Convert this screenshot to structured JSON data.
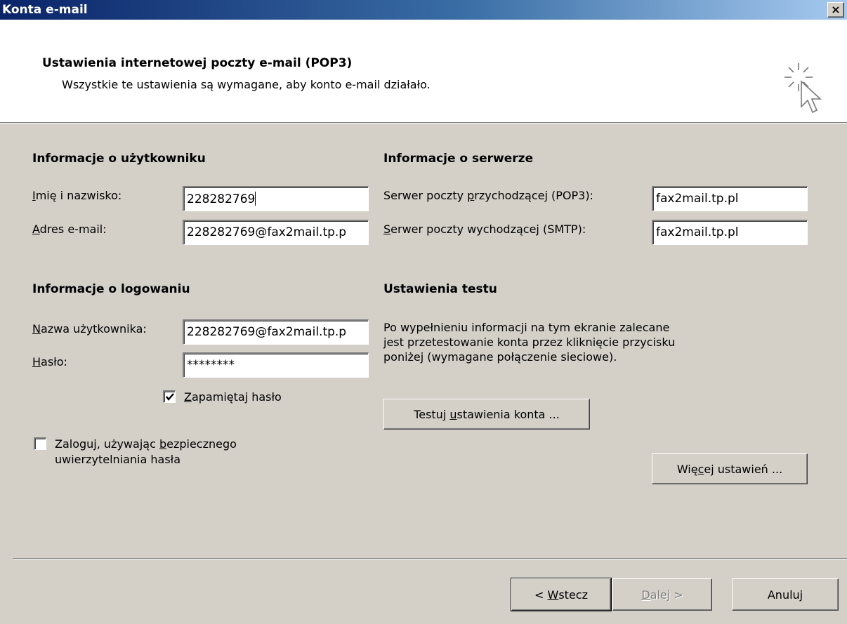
{
  "window": {
    "title": "Konta e-mail",
    "close_glyph": "×"
  },
  "header": {
    "title": "Ustawienia internetowej poczty e-mail (POP3)",
    "subtitle": "Wszystkie te ustawienia są wymagane, aby konto e-mail działało.",
    "icon": "wizard-cursor-sparkle-icon"
  },
  "user_info": {
    "heading": "Informacje o użytkowniku",
    "name_label_key": "I",
    "name_label_rest": "mię i nazwisko:",
    "name_value": "228282769",
    "email_label_key": "A",
    "email_label_rest": "dres e-mail:",
    "email_value": "228282769@fax2mail.tp.p"
  },
  "server_info": {
    "heading": "Informacje o serwerze",
    "incoming_label_pre": "Serwer poczty ",
    "incoming_label_key": "p",
    "incoming_label_rest": "rzychodzącej (POP3):",
    "incoming_value": "fax2mail.tp.pl",
    "outgoing_label_key": "S",
    "outgoing_label_rest": "erwer poczty wychodzącej (SMTP):",
    "outgoing_value": "fax2mail.tp.pl"
  },
  "login_info": {
    "heading": "Informacje o logowaniu",
    "username_label_key": "N",
    "username_label_rest": "azwa użytkownika:",
    "username_value": "228282769@fax2mail.tp.p",
    "password_label_key": "H",
    "password_label_rest": "asło:",
    "password_value": "********",
    "remember_key": "Z",
    "remember_rest": "apamiętaj hasło",
    "remember_checked": true,
    "spa_pre": "Zaloguj, używając ",
    "spa_key": "b",
    "spa_rest": "ezpiecznego",
    "spa_line2": "uwierzytelniania hasła",
    "spa_checked": false
  },
  "test_settings": {
    "heading": "Ustawienia testu",
    "desc_line1": "Po wypełnieniu informacji na tym ekranie zalecane",
    "desc_line2": "jest przetestowanie konta przez kliknięcie przycisku",
    "desc_line3": "poniżej (wymagane połączenie sieciowe).",
    "test_btn_pre": "Testuj ",
    "test_btn_key": "u",
    "test_btn_rest": "stawienia konta ..."
  },
  "more_btn": {
    "pre": "Wię",
    "key": "c",
    "rest": "ej ustawień ..."
  },
  "nav": {
    "back_pre": "< ",
    "back_key": "W",
    "back_rest": "stecz",
    "next_key": "D",
    "next_rest": "alej >",
    "cancel": "Anuluj"
  }
}
